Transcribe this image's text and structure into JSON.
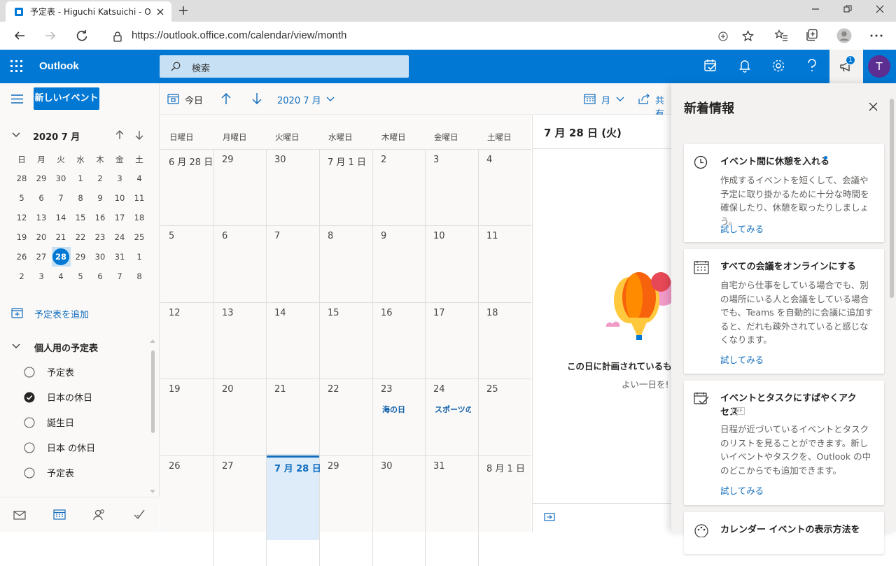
{
  "browser": {
    "tab_title": "予定表 - Higuchi Katsuichi - Outlook",
    "url": "https://outlook.office.com/calendar/view/month"
  },
  "app": {
    "name": "Outlook",
    "search_placeholder": "検索",
    "avatar_initial": "T",
    "notification_count": "1"
  },
  "sidebar": {
    "new_event": "新しいイベント",
    "mini_month": "2020 7 月",
    "weekdays": [
      "日",
      "月",
      "火",
      "水",
      "木",
      "金",
      "土"
    ],
    "weeks": [
      [
        "28",
        "29",
        "30",
        "1",
        "2",
        "3",
        "4"
      ],
      [
        "5",
        "6",
        "7",
        "8",
        "9",
        "10",
        "11"
      ],
      [
        "12",
        "13",
        "14",
        "15",
        "16",
        "17",
        "18"
      ],
      [
        "19",
        "20",
        "21",
        "22",
        "23",
        "24",
        "25"
      ],
      [
        "26",
        "27",
        "28",
        "29",
        "30",
        "31",
        "1"
      ],
      [
        "2",
        "3",
        "4",
        "5",
        "6",
        "7",
        "8"
      ]
    ],
    "add_calendar": "予定表を追加",
    "group_title": "個人用の予定表",
    "calendars": [
      {
        "label": "予定表",
        "checked": false
      },
      {
        "label": "日本の休日",
        "checked": true
      },
      {
        "label": "誕生日",
        "checked": false
      },
      {
        "label": "日本 の休日",
        "checked": false
      },
      {
        "label": "予定表",
        "checked": false
      }
    ]
  },
  "toolbar": {
    "today": "今日",
    "month_label": "2020 7 月",
    "view": "月",
    "share": "共有"
  },
  "month": {
    "weekday_headers": [
      "日曜日",
      "月曜日",
      "火曜日",
      "水曜日",
      "木曜日",
      "金曜日",
      "土曜日"
    ],
    "weeks": [
      [
        "6 月 28 日",
        "29",
        "30",
        "7 月 1 日",
        "2",
        "3",
        "4"
      ],
      [
        "5",
        "6",
        "7",
        "8",
        "9",
        "10",
        "11"
      ],
      [
        "12",
        "13",
        "14",
        "15",
        "16",
        "17",
        "18"
      ],
      [
        "19",
        "20",
        "21",
        "22",
        "23",
        "24",
        "25"
      ],
      [
        "26",
        "27",
        "7 月 28 日",
        "29",
        "30",
        "31",
        "8 月 1 日"
      ]
    ],
    "events": [
      {
        "week": 3,
        "day": 4,
        "label": "海の日"
      },
      {
        "week": 3,
        "day": 5,
        "label": "スポーツの日"
      }
    ]
  },
  "day_view": {
    "date": "7 月 28 日 (火)",
    "empty_title": "この日に計画されているもの",
    "empty_sub": "よい一日を!"
  },
  "whats_new": {
    "title": "新着情報",
    "cards": [
      {
        "title": "イベント間に休憩を入れる",
        "body": "作成するイベントを短くして、会議や予定に取り掛かるために十分な時間を確保したり、休憩を取ったりしましょう。",
        "link": "試してみる"
      },
      {
        "title": "すべての会議をオンラインにする",
        "body": "自宅から仕事をしている場合でも、別の場所にいる人と会議をしている場合でも、Teams を自動的に会議に追加すると、だれも疎外されていると感じなくなります。",
        "link": "試してみる"
      },
      {
        "title": "イベントとタスクにすばやくアクセス",
        "gif": "GIF",
        "body": "日程が近づいているイベントとタスクのリストを見ることができます。新しいイベントやタスクを、Outlook の中のどこからでも追加できます。",
        "link": "試してみる"
      },
      {
        "title": "カレンダー イベントの表示方法を"
      }
    ]
  },
  "colors": {
    "accent": "#0078d4",
    "topbar": "#0078d4",
    "search": "#c7e0f4",
    "today_cell": "#deecf9"
  }
}
